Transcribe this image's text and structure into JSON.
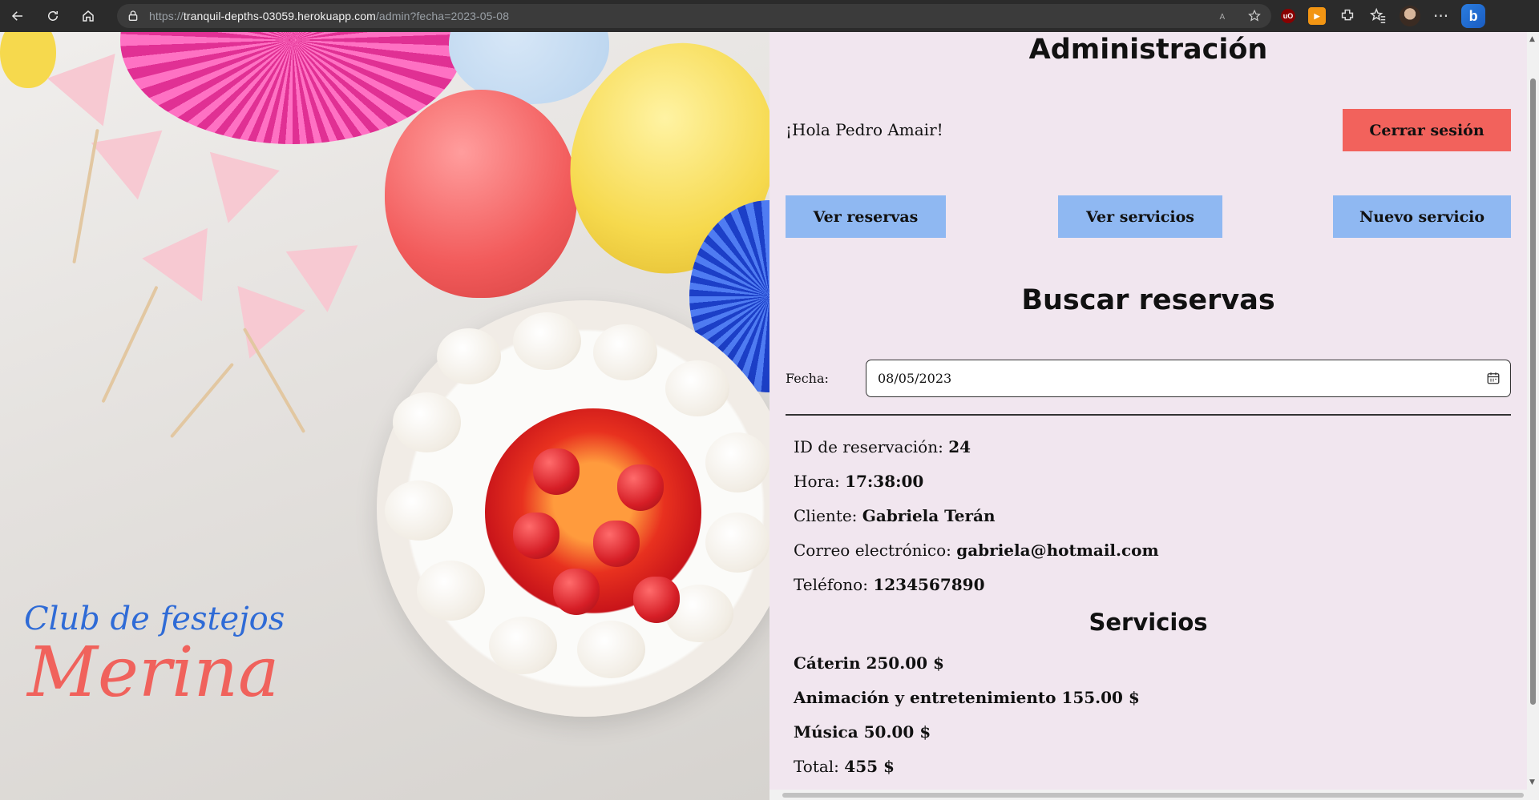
{
  "browser": {
    "url_prefix": "https://",
    "url_host": "tranquil-depths-03059.herokuapp.com",
    "url_path": "/admin?fecha=2023-05-08"
  },
  "hero": {
    "brand_line1": "Club de festejos",
    "brand_line2": "Merina"
  },
  "admin": {
    "title": "Administración",
    "greeting": "¡Hola Pedro Amair!",
    "logout_label": "Cerrar sesión",
    "nav": {
      "reservas": "Ver reservas",
      "servicios": "Ver servicios",
      "nuevo": "Nuevo servicio"
    },
    "search_title": "Buscar reservas",
    "fecha_label": "Fecha:",
    "fecha_value": "08/05/2023"
  },
  "reserva": {
    "id_label": "ID de reservación: ",
    "id": "24",
    "hora_label": "Hora: ",
    "hora": "17:38:00",
    "cliente_label": "Cliente: ",
    "cliente": "Gabriela Terán",
    "correo_label": "Correo electrónico: ",
    "correo": "gabriela@hotmail.com",
    "telefono_label": "Teléfono: ",
    "telefono": "1234567890"
  },
  "servicios": {
    "title": "Servicios",
    "items": [
      "Cáterin 250.00 $",
      "Animación y entretenimiento 155.00 $",
      "Música 50.00 $"
    ],
    "total_label": "Total: ",
    "total": "455 $"
  },
  "colors": {
    "panel_bg": "#f1e6ef",
    "logout_bg": "#f2625c",
    "nav_bg": "#8fb8f2",
    "brand_blue": "#2f6bd6",
    "brand_coral": "#f0625c"
  }
}
